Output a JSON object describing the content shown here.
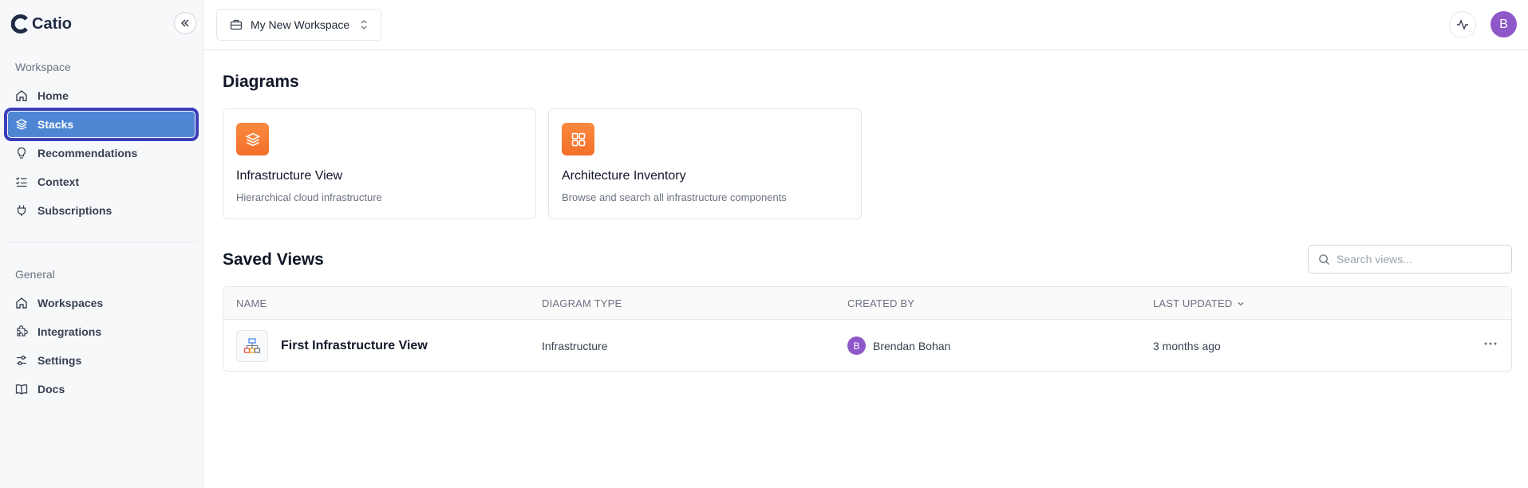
{
  "app": {
    "name": "Catio"
  },
  "sidebar": {
    "workspace_label": "Workspace",
    "general_label": "General",
    "items": [
      {
        "label": "Home",
        "icon": "home-icon"
      },
      {
        "label": "Stacks",
        "icon": "layers-icon",
        "active": true
      },
      {
        "label": "Recommendations",
        "icon": "lightbulb-icon"
      },
      {
        "label": "Context",
        "icon": "list-checks-icon"
      },
      {
        "label": "Subscriptions",
        "icon": "plug-icon"
      }
    ],
    "general_items": [
      {
        "label": "Workspaces",
        "icon": "home-icon"
      },
      {
        "label": "Integrations",
        "icon": "puzzle-icon"
      },
      {
        "label": "Settings",
        "icon": "sliders-icon"
      },
      {
        "label": "Docs",
        "icon": "book-icon"
      }
    ]
  },
  "topbar": {
    "workspace": "My New Workspace",
    "avatar_initial": "B"
  },
  "diagrams": {
    "title": "Diagrams",
    "cards": [
      {
        "title": "Infrastructure View",
        "description": "Hierarchical cloud infrastructure",
        "icon": "layers-icon"
      },
      {
        "title": "Architecture Inventory",
        "description": "Browse and search all infrastructure components",
        "icon": "grid-icon"
      }
    ]
  },
  "saved_views": {
    "title": "Saved Views",
    "search_placeholder": "Search views...",
    "columns": [
      "NAME",
      "DIAGRAM TYPE",
      "CREATED BY",
      "LAST UPDATED"
    ],
    "sort_column": "LAST UPDATED",
    "rows": [
      {
        "name": "First Infrastructure View",
        "type": "Infrastructure",
        "creator": "Brendan Bohan",
        "creator_initial": "B",
        "updated": "3 months ago"
      }
    ]
  },
  "colors": {
    "accent": "#4f86d4",
    "active_outline": "#3a3fb8",
    "card_icon": "#f47b34",
    "avatar": "#8f58c9"
  }
}
